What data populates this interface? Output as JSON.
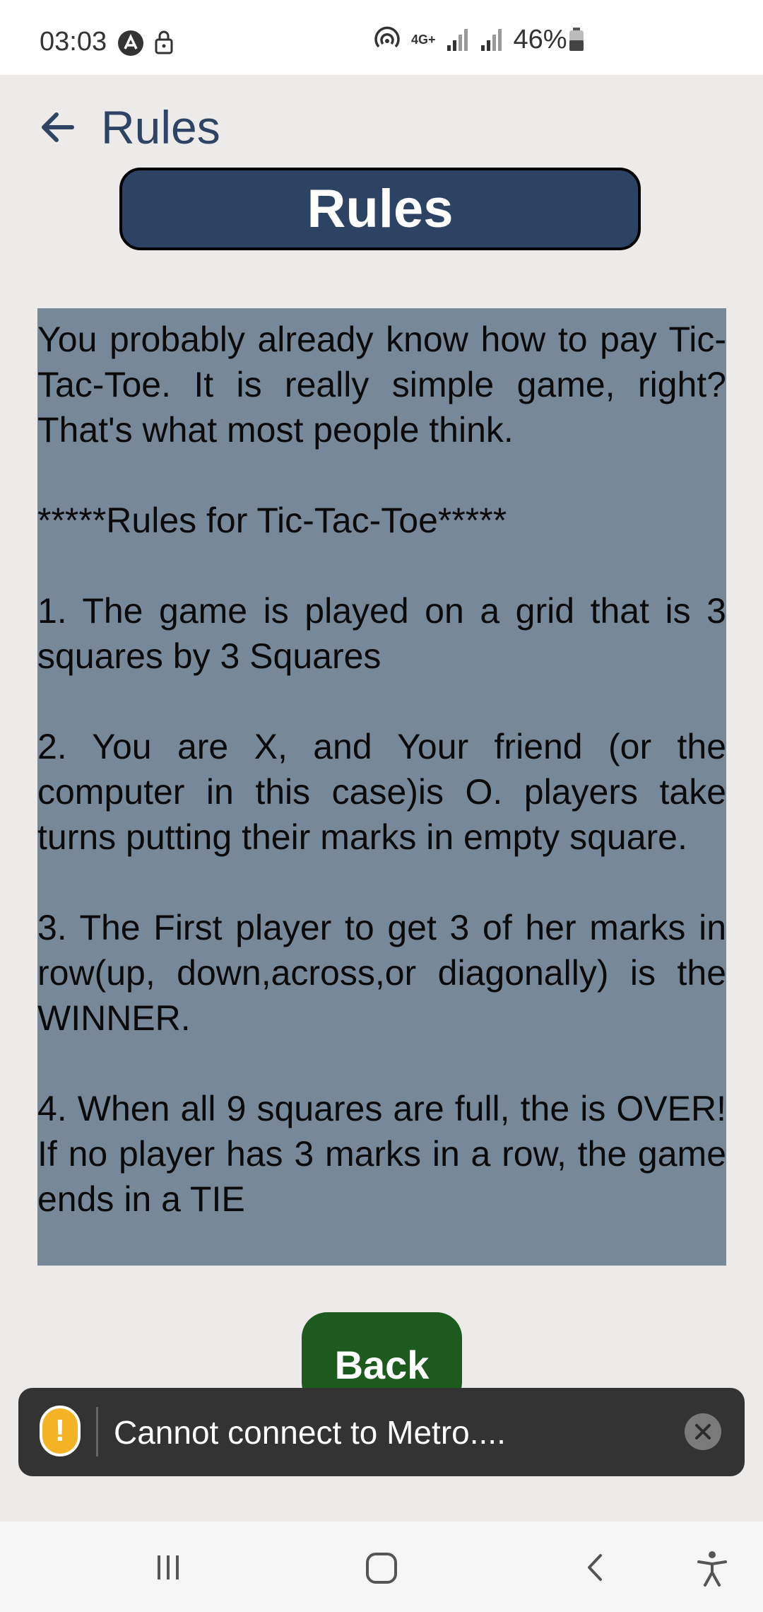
{
  "status_bar": {
    "time": "03:03",
    "network": "4G+",
    "battery": "46%",
    "icons": [
      "alert-a-icon",
      "lock-icon",
      "hotspot-icon",
      "signal-icon",
      "signal-icon",
      "battery-icon"
    ]
  },
  "app_bar": {
    "title": "Rules",
    "back_icon": "arrow-left-icon"
  },
  "header": {
    "label": "Rules"
  },
  "rules": {
    "paragraphs": [
      "You probably already know how to pay Tic-Tac-Toe. It is really simple game, right? That's what most people think.",
      "*****Rules for Tic-Tac-Toe*****",
      "1. The game is played on a grid that is 3 squares by 3 Squares",
      "2. You are X, and Your friend (or the computer in this case)is O. players take turns putting their marks in empty square.",
      "3. The First player to get 3 of her marks in row(up, down,across,or diagonally) is the WINNER.",
      "4. When all 9 squares are full, the is OVER! If no player has 3 marks in a row, the game ends in a TIE"
    ]
  },
  "back_button": {
    "label": "Back"
  },
  "toast": {
    "text": "Cannot connect to Metro....",
    "icon": "warning-icon",
    "close_icon": "close-icon"
  },
  "nav_bar": {
    "items": [
      "recents-icon",
      "home-icon",
      "back-icon",
      "accessibility-icon"
    ]
  },
  "colors": {
    "app_bar_title": "#2f4364",
    "header_bg": "#2d4363",
    "rules_bg": "#778898",
    "back_button_bg": "#1d5a1e",
    "toast_bg": "#333333",
    "toast_warning": "#f4b324"
  }
}
